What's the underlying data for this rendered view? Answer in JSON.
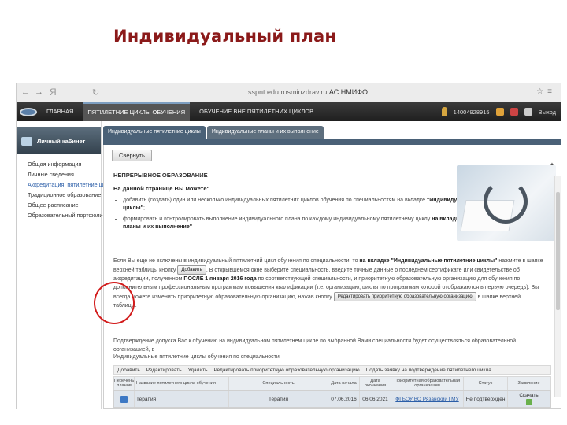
{
  "slide_title": "Индивидуальный план",
  "browser": {
    "yandex_label": "Я",
    "url_text": "sspnt.edu.rosminzdrav.ru",
    "url_title": "АС НМИФО"
  },
  "header": {
    "menu_main": "Главная",
    "menu_cycles": "Пятилетние циклы обучения",
    "menu_outside": "Обучение вне пятилетних циклов",
    "user_id": "14004928915",
    "logout": "Выход"
  },
  "sidebar": {
    "cabinet": "Личный кабинет",
    "items": [
      "Общая информация",
      "Личные сведения",
      "Аккредитация: пятилетние циклы",
      "Традиционное образование",
      "Общее расписание",
      "Образовательный портфолио"
    ]
  },
  "tabs": {
    "tab1": "Индивидуальные пятилетние циклы",
    "tab2": "Индивидуальные планы и их выполнение"
  },
  "collapse_button": "Свернуть",
  "info": {
    "heading": "НЕПРЕРЫВНОЕ ОБРАЗОВАНИЕ",
    "subheading": "На данной странице Вы можете:",
    "bullet1_text": "добавить (создать) один или несколько индивидуальных пятилетних циклов обучения по специальностям на вкладке ",
    "bullet1_bold": "\"Индивидуальные пятилетние циклы\"",
    "bullet2_text": "формировать и контролировать выполнение индивидуального плана по каждому индивидуальному пятилетнему циклу ",
    "bullet2_bold": "на вкладке \"Индивидуальные планы и их выполнение\""
  },
  "para1": {
    "text_a": "Если Вы еще не включены в индивидуальный пятилетний цикл обучения по специальности, то ",
    "bold_a": "на вкладке \"Индивидуальные пятилетние циклы\"",
    "text_b": " нажмите в шапке верхней таблицы кнопку ",
    "add_button": "Добавить",
    "text_c": ". В открывшемся окне выберите специальность, введите точные данные о последнем сертификате или свидетельстве об аккредитации, полученном ",
    "bold_b": "ПОСЛЕ 1 января 2016 года",
    "text_d": " по соответствующей специальности, и приоритетную образовательную организацию для обучения по дополнительным профессиональным программам повышения квалификации (т.е. организацию, циклы по программам которой отображаются в первую очередь). Вы всегда можете изменить приоритетную образовательную организацию, нажав кнопку ",
    "edit_button": "Редактировать приоритетную образовательную организацию",
    "text_e": " в шапке верхней таблицы."
  },
  "para2": "Подтверждение допуска Вас к обучению на индивидуальном пятилетнем цикле по выбранной Вами специальности будет осуществляться образовательной организацией, в",
  "section_label": "Индивидуальные пятилетние циклы обучения по специальности",
  "toolbar": {
    "add": "Добавить",
    "edit": "Редактировать",
    "delete": "Удалить",
    "edit_priority": "Редактировать приоритетную образовательную организацию",
    "submit": "Подать заявку на подтверждение пятилетнего цикла"
  },
  "table": {
    "headers": [
      "Перечень планов",
      "Название пятилетнего цикла обучения",
      "Специальность",
      "Дата начала",
      "Дата окончания",
      "Приоритетная образовательная организация",
      "Статус",
      "Заявление"
    ],
    "row": {
      "name": "Терапия",
      "specialty": "Терапия",
      "start": "07.06.2016",
      "end": "06.06.2021",
      "org": "ФГБОУ ВО Рязанский ГМУ",
      "status": "Не подтвержден",
      "download": "Скачать"
    }
  }
}
